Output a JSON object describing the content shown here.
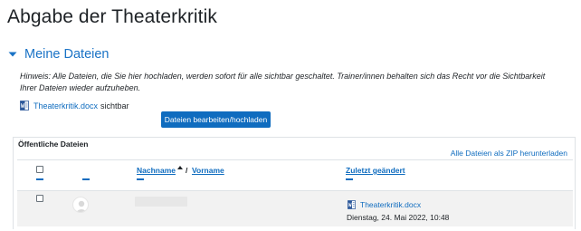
{
  "page": {
    "title": "Abgabe der Theaterkritik"
  },
  "section": {
    "label": "Meine Dateien",
    "hint": "Hinweis: Alle Dateien, die Sie hier hochladen, werden sofort für alle sichtbar geschaltet. Trainer/innen behalten sich das Recht vor die Sichtbarkeit Ihrer Dateien wieder aufzuheben.",
    "file_name": "Theaterkritik.docx",
    "file_visibility": "sichtbar",
    "upload_button": "Dateien bearbeiten/hochladen"
  },
  "public_files": {
    "title": "Öffentliche Dateien",
    "zip_link": "Alle Dateien als ZIP herunterladen",
    "columns": {
      "lastname": "Nachname",
      "separator": "/",
      "firstname": "Vorname",
      "last_modified": "Zuletzt geändert"
    },
    "rows": [
      {
        "file_name": "Theaterkritik.docx",
        "date": "Dienstag, 24. Mai 2022, 10:48"
      }
    ]
  },
  "colors": {
    "link": "#0f6cbf",
    "section_label": "#1a73c6",
    "row_bg": "#f2f2f2"
  },
  "icons": {
    "chevron": "chevron-down-icon",
    "document": "word-document-icon",
    "sort": "sort-ascending-icon",
    "avatar": "user-avatar-icon"
  }
}
